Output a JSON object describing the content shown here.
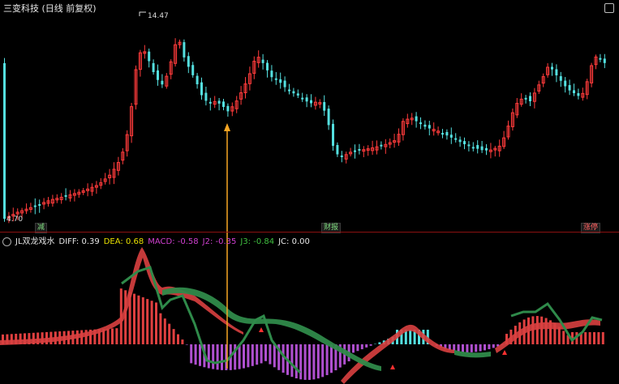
{
  "header": {
    "title": "三变科技 (日线 前复权)"
  },
  "price_panel": {
    "high_label": "14.47",
    "low_label": "4.70",
    "event_labels": [
      {
        "id": "ev1",
        "text": "减"
      },
      {
        "id": "ev2",
        "text": "财报"
      },
      {
        "id": "ev3",
        "text": "涨停"
      }
    ]
  },
  "indicator": {
    "name": "JL双龙戏水",
    "values": [
      {
        "id": "diff",
        "label": "DIFF: 0.39",
        "color": "#e6e6e6"
      },
      {
        "id": "dea",
        "label": "DEA: 0.68",
        "color": "#e8e000"
      },
      {
        "id": "macd",
        "label": "MACD: -0.58",
        "color": "#d040d0"
      },
      {
        "id": "j2",
        "label": "J2: -0.35",
        "color": "#d040d0"
      },
      {
        "id": "j3",
        "label": "J3: -0.84",
        "color": "#40c040"
      },
      {
        "id": "jc",
        "label": "JC: 0.00",
        "color": "#e6e6e6"
      }
    ]
  },
  "colors": {
    "up": "#ff3b3b",
    "down": "#54e0e0",
    "red_band": "#d94040",
    "green_band": "#2f8a4a",
    "marker": "#f5a623"
  },
  "chart_data": [
    {
      "type": "candlestick",
      "title": "三变科技 (日线 前复权)",
      "annotations": [
        "14.47",
        "4.70"
      ],
      "price_range": [
        4.7,
        14.47
      ]
    },
    {
      "type": "bar",
      "title": "JL双龙戏水",
      "series": [
        {
          "name": "DIFF",
          "values": [
            0.39
          ]
        },
        {
          "name": "DEA",
          "values": [
            0.68
          ]
        },
        {
          "name": "MACD",
          "values": [
            -0.58
          ]
        },
        {
          "name": "J2",
          "values": [
            -0.35
          ]
        },
        {
          "name": "J3",
          "values": [
            -0.84
          ]
        },
        {
          "name": "JC",
          "values": [
            0.0
          ]
        }
      ]
    }
  ]
}
